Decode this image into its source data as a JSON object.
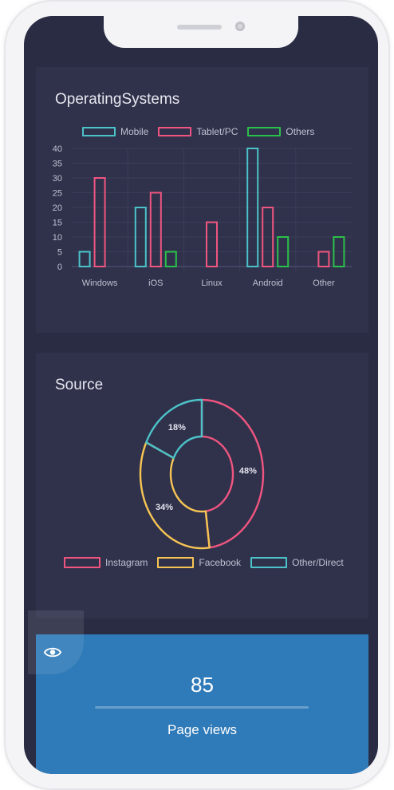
{
  "colors": {
    "mobile": "#4cc3c9",
    "tablet": "#f0557f",
    "others": "#2ac14a",
    "instagram": "#f0557f",
    "facebook": "#f7c553",
    "other_direct": "#4cc3c9",
    "stat_bg": "#2f7ab8"
  },
  "os_card": {
    "title": "OperatingSystems",
    "legend": [
      "Mobile",
      "Tablet/PC",
      "Others"
    ]
  },
  "source_card": {
    "title": "Source",
    "legend": [
      "Instagram",
      "Facebook",
      "Other/Direct"
    ]
  },
  "stat": {
    "icon": "eye-icon",
    "value": "85",
    "label": "Page views"
  },
  "chart_data": [
    {
      "type": "bar",
      "categories": [
        "Windows",
        "iOS",
        "Linux",
        "Android",
        "Other"
      ],
      "series": [
        {
          "name": "Mobile",
          "values": [
            5,
            20,
            0,
            40,
            0
          ]
        },
        {
          "name": "Tablet/PC",
          "values": [
            30,
            25,
            15,
            20,
            5
          ]
        },
        {
          "name": "Others",
          "values": [
            0,
            5,
            0,
            10,
            10
          ]
        }
      ],
      "ylim": [
        0,
        40
      ],
      "yticks": [
        0,
        5,
        10,
        15,
        20,
        25,
        30,
        35,
        40
      ],
      "grid": true,
      "legend": "top"
    },
    {
      "type": "pie",
      "labels": [
        "Instagram",
        "Facebook",
        "Other/Direct"
      ],
      "values": [
        48,
        34,
        18
      ],
      "value_labels": [
        "48%",
        "34%",
        "18%"
      ],
      "donut": true,
      "legend": "bottom"
    }
  ]
}
